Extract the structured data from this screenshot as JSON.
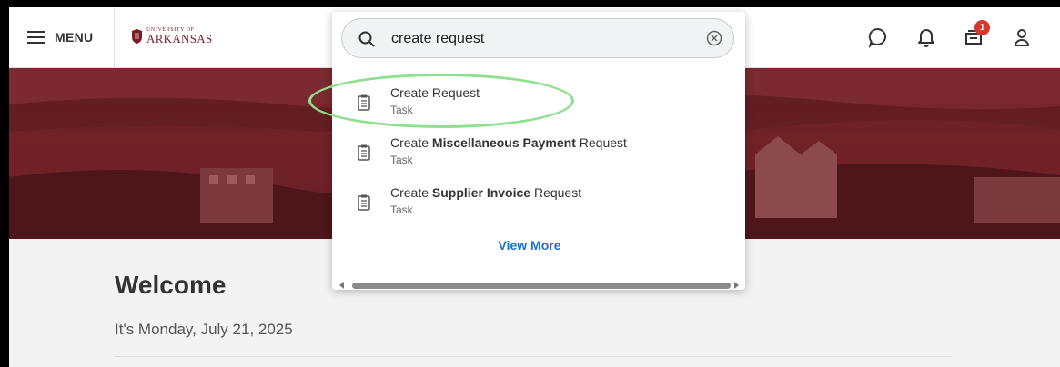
{
  "topbar": {
    "menu_label": "MENU",
    "logo": {
      "small": "UNIVERSITY OF",
      "big": "ARKANSAS"
    },
    "icons": [
      "chat-icon",
      "bell-icon",
      "inbox-icon",
      "user-icon"
    ],
    "inbox_badge": "1"
  },
  "search": {
    "value": "create request",
    "results": [
      {
        "prefix": "Create ",
        "bold": "",
        "suffix": "Request",
        "type": "Task"
      },
      {
        "prefix": "Create ",
        "bold": "Miscellaneous Payment",
        "suffix": " Request",
        "type": "Task"
      },
      {
        "prefix": "Create ",
        "bold": "Supplier Invoice",
        "suffix": " Request",
        "type": "Task"
      }
    ],
    "view_more": "View More"
  },
  "main": {
    "welcome": "Welcome",
    "date": "It's Monday, July 21, 2025"
  },
  "colors": {
    "brand": "#7a1c24",
    "hero": "#6a1e24",
    "link": "#1a73c8",
    "badge": "#d8352b",
    "highlight": "#8ee08e"
  }
}
